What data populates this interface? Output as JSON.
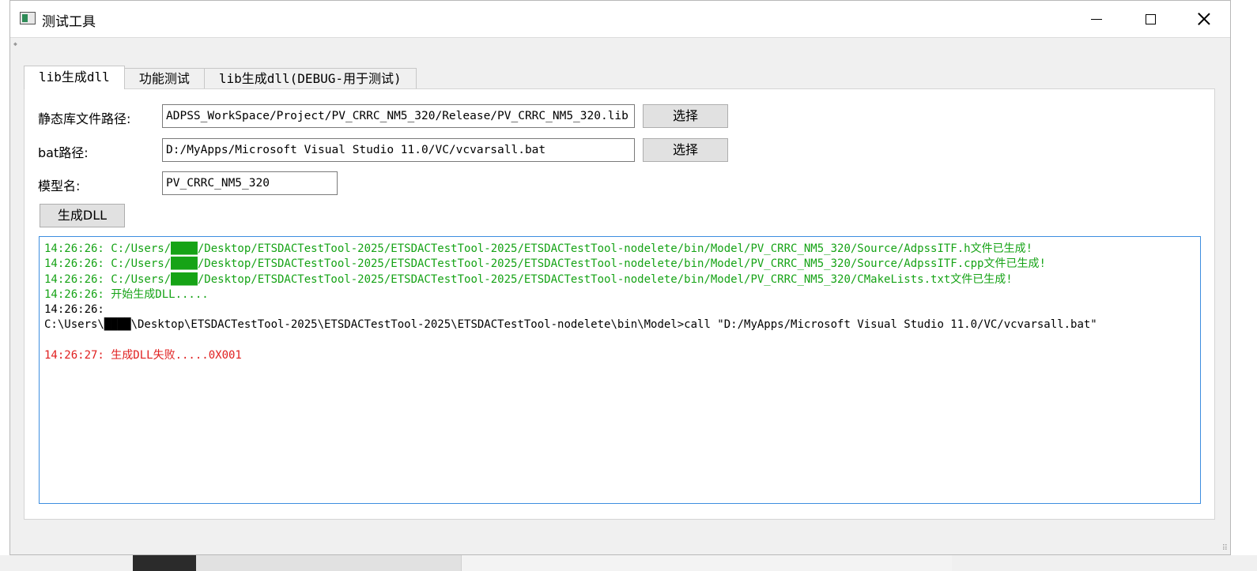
{
  "window": {
    "title": "测试工具",
    "minimize_glyph": "",
    "maximize_glyph": "",
    "close_glyph": ""
  },
  "tabs": [
    {
      "label": "lib生成dll",
      "active": true
    },
    {
      "label": "功能测试",
      "active": false
    },
    {
      "label": "lib生成dll(DEBUG-用于测试)",
      "active": false
    }
  ],
  "form": {
    "lib_path_label": "静态库文件路径:",
    "lib_path_value": "ADPSS_WorkSpace/Project/PV_CRRC_NM5_320/Release/PV_CRRC_NM5_320.lib",
    "lib_browse_label": "选择",
    "bat_path_label": "bat路径:",
    "bat_path_value": "D:/MyApps/Microsoft Visual Studio 11.0/VC/vcvarsall.bat",
    "bat_browse_label": "选择",
    "model_name_label": "模型名:",
    "model_name_value": "PV_CRRC_NM5_320",
    "generate_label": "生成DLL"
  },
  "log": {
    "lines": [
      {
        "text": "14:26:26: C:/Users/████/Desktop/ETSDACTestTool-2025/ETSDACTestTool-2025/ETSDACTestTool-nodelete/bin/Model/PV_CRRC_NM5_320/Source/AdpssITF.h文件已生成!",
        "color": "green"
      },
      {
        "text": "14:26:26: C:/Users/████/Desktop/ETSDACTestTool-2025/ETSDACTestTool-2025/ETSDACTestTool-nodelete/bin/Model/PV_CRRC_NM5_320/Source/AdpssITF.cpp文件已生成!",
        "color": "green"
      },
      {
        "text": "14:26:26: C:/Users/████/Desktop/ETSDACTestTool-2025/ETSDACTestTool-2025/ETSDACTestTool-nodelete/bin/Model/PV_CRRC_NM5_320/CMakeLists.txt文件已生成!",
        "color": "green"
      },
      {
        "text": "14:26:26: 开始生成DLL.....",
        "color": "green"
      },
      {
        "text": "14:26:26:",
        "color": "black"
      },
      {
        "text": "C:\\Users\\████\\Desktop\\ETSDACTestTool-2025\\ETSDACTestTool-2025\\ETSDACTestTool-nodelete\\bin\\Model>call \"D:/MyApps/Microsoft Visual Studio 11.0/VC/vcvarsall.bat\"",
        "color": "black"
      },
      {
        "text": " ",
        "color": "black"
      },
      {
        "text": "14:26:27: 生成DLL失败.....0X001",
        "color": "red"
      }
    ]
  },
  "colors": {
    "log_green": "#16a316",
    "log_red": "#e02020",
    "focus_border": "#3d8ee0"
  }
}
